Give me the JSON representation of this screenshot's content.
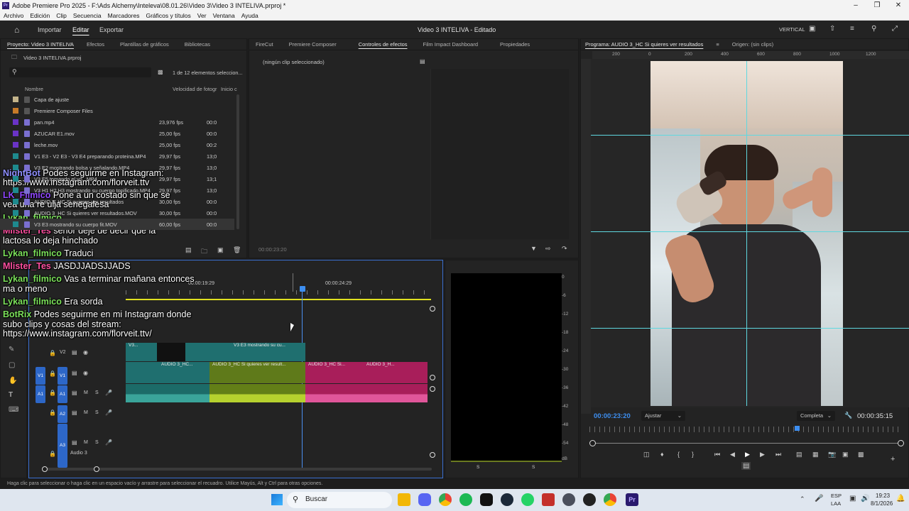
{
  "window": {
    "title": "Adobe Premiere Pro 2025 - F:\\Ads Alchemy\\Inteleva\\08.01.26\\Video 3\\Video 3 INTELIVA.prproj *"
  },
  "menu": [
    "Archivo",
    "Edición",
    "Clip",
    "Secuencia",
    "Marcadores",
    "Gráficos y títulos",
    "Ver",
    "Ventana",
    "Ayuda"
  ],
  "appbar": {
    "nav": [
      "Importar",
      "Editar",
      "Exportar"
    ],
    "active": "Editar",
    "center": "Video 3 INTELIVA - Editado",
    "layout": "VERTICAL"
  },
  "project": {
    "tabs": [
      "Proyecto: Video 3 INTELIVA",
      "Efectos",
      "Plantillas de gráficos",
      "Bibliotecas"
    ],
    "file": "Video 3 INTELIVA.prproj",
    "count": "1 de 12 elementos seleccion...",
    "columns": [
      "Nombre",
      "Velocidad de fotogr",
      "Inicio c"
    ],
    "rows": [
      {
        "name": "Capa de ajuste",
        "fps": "",
        "start": "",
        "color": "#c3b38a"
      },
      {
        "name": "Premiere Composer Files",
        "fps": "",
        "start": "",
        "color": "#c77a28"
      },
      {
        "name": "pan.mp4",
        "fps": "23,976 fps",
        "start": "00:0",
        "color": "#6a33c7"
      },
      {
        "name": "AZUCAR E1.mov",
        "fps": "25,00 fps",
        "start": "00:0",
        "color": "#6a33c7"
      },
      {
        "name": "leche.mov",
        "fps": "25,00 fps",
        "start": "00:2",
        "color": "#6a33c7"
      },
      {
        "name": "V1 E3 - V2 E3 - V3 E4 preparando proteina.MP4",
        "fps": "29,97 fps",
        "start": "13;0",
        "color": "#1e8a8e"
      },
      {
        "name": "V3 E2 mostrando bolsa y señalando.MP4",
        "fps": "29,97 fps",
        "start": "13;0",
        "color": "#1e8a8e"
      },
      {
        "name": "V3 E5 tomando el yo...MP4",
        "fps": "29,97 fps",
        "start": "13;1",
        "color": "#1e8a8e"
      },
      {
        "name": "V3 H1 H2 H3 mostrando su cuerpo tonificado.MP4",
        "fps": "29,97 fps",
        "start": "13;0",
        "color": "#1e8a8e"
      },
      {
        "name": "AUDIO 3_HC Si quieres ver resultados",
        "fps": "30,00 fps",
        "start": "00:0",
        "color": "#1e8a8e"
      },
      {
        "name": "AUDIO 3_HC Si quieres ver resultados.MOV",
        "fps": "30,00 fps",
        "start": "00:0",
        "color": "#1e8a8e"
      },
      {
        "name": "V3 E3 mostrando su cuerpo fit.MOV",
        "fps": "60,00 fps",
        "start": "00:0",
        "color": "#1e8a8e"
      }
    ]
  },
  "effects": {
    "tabs": [
      "FireCut",
      "Premiere Composer",
      "Controles de efectos",
      "Film Impact Dashboard",
      "Propiedades"
    ],
    "active": "Controles de efectos",
    "empty": "(ningún clip seleccionado)",
    "time": "00:00:23:20"
  },
  "program": {
    "tabs": [
      "Programa: AUDIO 3_HC Si quieres ver resultados",
      "Origen: (sin clips)"
    ],
    "ruler": [
      "200",
      "0",
      "200",
      "400",
      "600",
      "800",
      "1000",
      "1200"
    ],
    "time_current": "00:00:23:20",
    "fit": "Ajustar",
    "quality": "Completa",
    "time_total": "00:00:35:15"
  },
  "timeline": {
    "timecodes": [
      "00:00:19:29",
      "00:00:24:29"
    ],
    "tracks": {
      "v2": "V2",
      "v1": "V1",
      "a1": "A1",
      "a2": "A2",
      "a3": "A3",
      "audio3": "Audio 3",
      "m": "M",
      "s": "S"
    },
    "clips": {
      "v2a": "V3...",
      "v2b": "V3 E3 mostrando su cu...",
      "v1a": "AUDIO 3_HC...",
      "v1b": "AUDIO 3_HC Si quieres ver result...",
      "v1c": "AUDIO 3_HC Si...",
      "v1d": "AUDIO 3_H...",
      "fx": "fx"
    }
  },
  "meter": {
    "labels": [
      "0",
      "-6",
      "-12",
      "-18",
      "-24",
      "-30",
      "-36",
      "-42",
      "-48",
      "-54",
      "dB"
    ],
    "bottom": [
      "S",
      "S"
    ]
  },
  "chat": [
    {
      "user": "NightBot",
      "text": "Podes seguirme en Instagram:",
      "color": "#8f8fff"
    },
    {
      "user": "",
      "text": "https://www.instagram.com/florveit.ttv",
      "color": "#fff"
    },
    {
      "user": "LK_Filmico",
      "text": "Pone a un costado sin que se",
      "color": "#9147ff"
    },
    {
      "user": "",
      "text": "vea una re ulja senegalesa",
      "color": "#fff"
    },
    {
      "user": "Lykan_filmico",
      "text": "",
      "color": "#7be05a"
    },
    {
      "user": "Mlister_Tes",
      "text": "señor deje de decir que la",
      "color": "#ff4fa0"
    },
    {
      "user": "",
      "text": "lactosa lo deja hinchado",
      "color": "#fff"
    },
    {
      "user": "Lykan_filmico",
      "text": "Traduci",
      "color": "#7be05a"
    },
    {
      "user": "Mlister_Tes",
      "text": "JASDJJADSJJADS",
      "color": "#ff4fa0"
    },
    {
      "user": "Lykan_filmico",
      "text": "Vas a terminar mañana entonces",
      "color": "#7be05a"
    },
    {
      "user": "",
      "text": "ma o meno",
      "color": "#fff"
    },
    {
      "user": "Lykan_filmico",
      "text": "Era sorda",
      "color": "#7be05a"
    },
    {
      "user": "BotRix",
      "text": "Podes seguirme en mi Instagram donde",
      "color": "#7be05a"
    },
    {
      "user": "",
      "text": "subo clips y cosas del stream:",
      "color": "#fff"
    },
    {
      "user": "",
      "text": "https://www.instagram.com/florveit.ttv/",
      "color": "#fff"
    }
  ],
  "status": "Haga clic para seleccionar o haga clic en un espacio vacío y arrastre para seleccionar el recuadro. Utilice Mayús, Alt y Ctrl para otras opciones.",
  "taskbar": {
    "search": "Buscar",
    "lang1": "ESP",
    "lang2": "LAA",
    "time": "19:23",
    "date": "8/1/2026"
  }
}
